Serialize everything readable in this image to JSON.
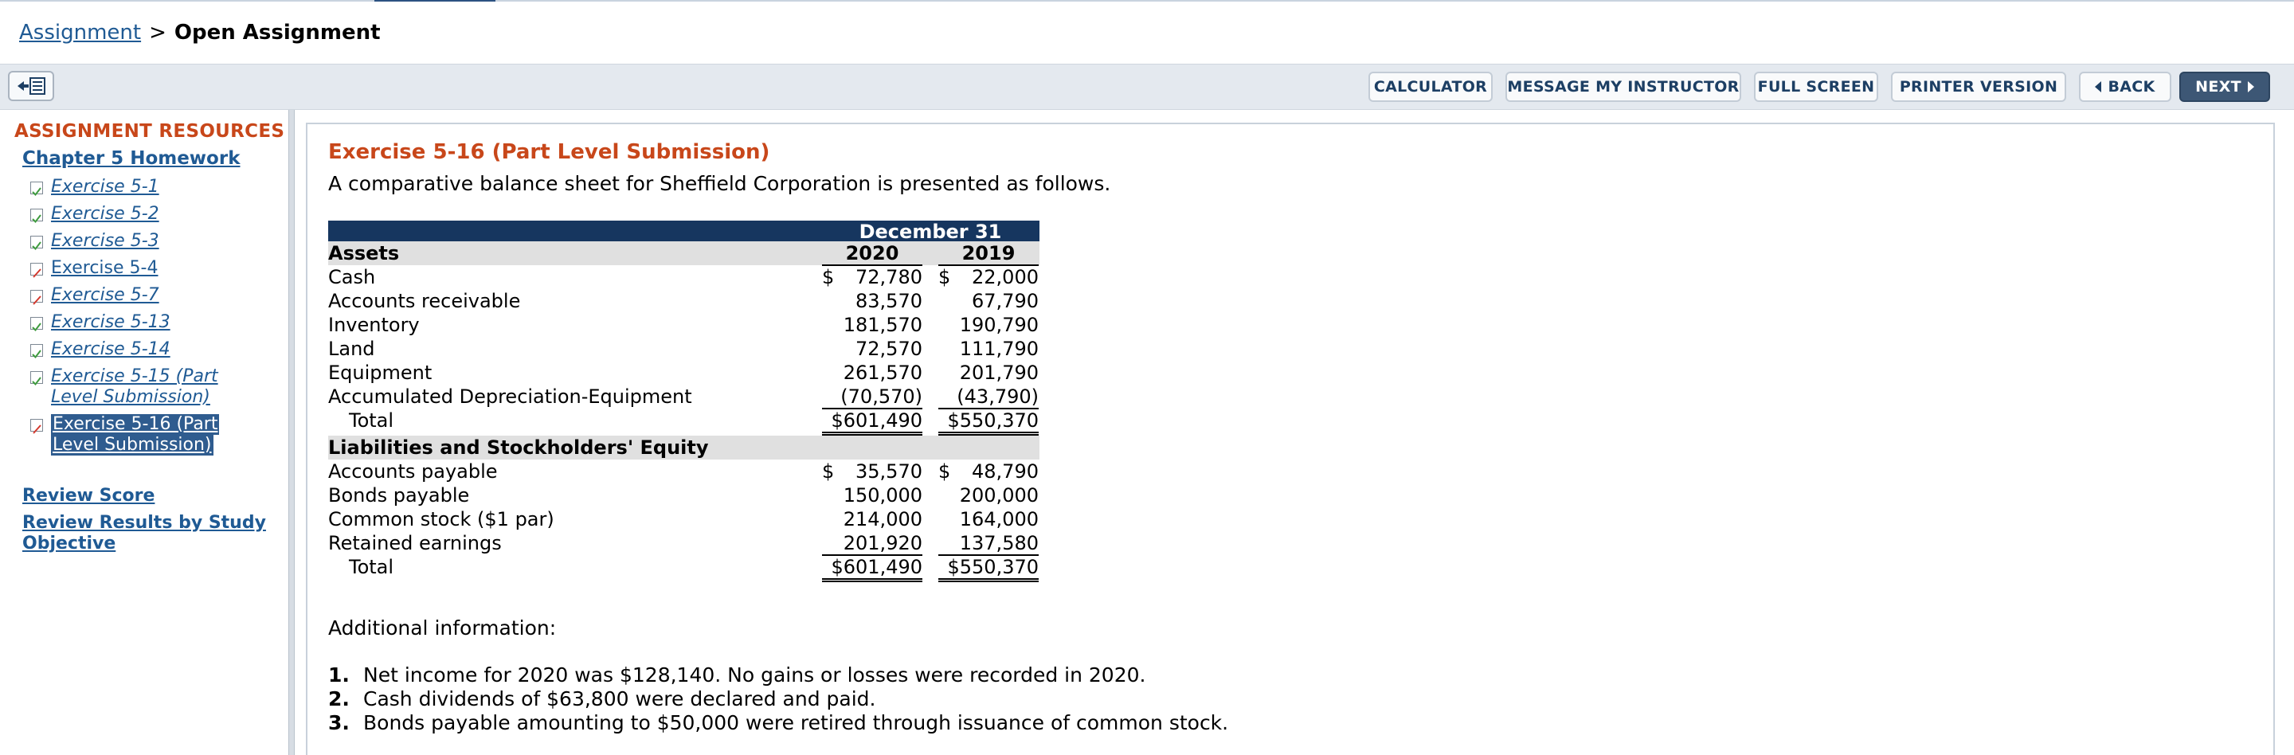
{
  "breadcrumb": {
    "link": "Assignment",
    "separator": ">",
    "current": "Open Assignment"
  },
  "toolbar": {
    "calculator": "CALCULATOR",
    "message": "MESSAGE MY INSTRUCTOR",
    "fullscreen": "FULL SCREEN",
    "printer": "PRINTER VERSION",
    "back": "BACK",
    "next": "NEXT"
  },
  "sidebar": {
    "heading": "ASSIGNMENT RESOURCES",
    "chapter": "Chapter 5 Homework",
    "items": [
      {
        "label": "Exercise 5-1",
        "status": "correct"
      },
      {
        "label": "Exercise 5-2",
        "status": "correct"
      },
      {
        "label": "Exercise 5-3",
        "status": "correct"
      },
      {
        "label": "Exercise 5-4",
        "status": "incorrect"
      },
      {
        "label": "Exercise 5-7",
        "status": "incorrect"
      },
      {
        "label": "Exercise 5-13",
        "status": "correct"
      },
      {
        "label": "Exercise 5-14",
        "status": "correct"
      },
      {
        "label_line1": "Exercise 5-15 (Part",
        "label_line2": "Level Submission)",
        "status": "correct"
      },
      {
        "label_line1": "Exercise 5-16 (Part",
        "label_line2": "Level Submission)",
        "status": "incorrect",
        "selected": true
      }
    ],
    "review_score": "Review Score",
    "review_results_line1": "Review Results by Study",
    "review_results_line2": "Objective"
  },
  "colors": {
    "accent": "#c8471a",
    "link": "#1f5a94",
    "header_navy": "#16365f",
    "check_green": "#3f9b3f",
    "check_red": "#d43a2f"
  },
  "content": {
    "title": "Exercise 5-16 (Part Level Submission)",
    "intro": "A comparative balance sheet for Sheffield Corporation is presented as follows.",
    "balance_sheet": {
      "period_header": "December 31",
      "years": [
        "2020",
        "2019"
      ],
      "assets_heading": "Assets",
      "assets": [
        {
          "label": "Cash",
          "v2020": "$ 72,780",
          "v2019": "$ 22,000"
        },
        {
          "label": "Accounts receivable",
          "v2020": "83,570",
          "v2019": "67,790"
        },
        {
          "label": "Inventory",
          "v2020": "181,570",
          "v2019": "190,790"
        },
        {
          "label": "Land",
          "v2020": "72,570",
          "v2019": "111,790"
        },
        {
          "label": "Equipment",
          "v2020": "261,570",
          "v2019": "201,790"
        },
        {
          "label": "Accumulated Depreciation-Equipment",
          "v2020": "(70,570)",
          "v2019": "(43,790)"
        }
      ],
      "assets_total": {
        "label": "Total",
        "v2020": "$601,490",
        "v2019": "$550,370"
      },
      "liab_heading": "Liabilities and Stockholders' Equity",
      "liabilities": [
        {
          "label": "Accounts payable",
          "v2020": "$ 35,570",
          "v2019": "$ 48,790"
        },
        {
          "label": "Bonds payable",
          "v2020": "150,000",
          "v2019": "200,000"
        },
        {
          "label": "Common stock ($1 par)",
          "v2020": "214,000",
          "v2019": "164,000"
        },
        {
          "label": "Retained earnings",
          "v2020": "201,920",
          "v2019": "137,580"
        }
      ],
      "liab_total": {
        "label": "Total",
        "v2020": "$601,490",
        "v2019": "$550,370"
      }
    },
    "additional_heading": "Additional information:",
    "notes": [
      {
        "num": "1.",
        "text": "Net income for 2020 was $128,140. No gains or losses were recorded in 2020."
      },
      {
        "num": "2.",
        "text": "Cash dividends of $63,800 were declared and paid."
      },
      {
        "num": "3.",
        "text": "Bonds payable amounting to $50,000 were retired through issuance of common stock."
      }
    ]
  }
}
